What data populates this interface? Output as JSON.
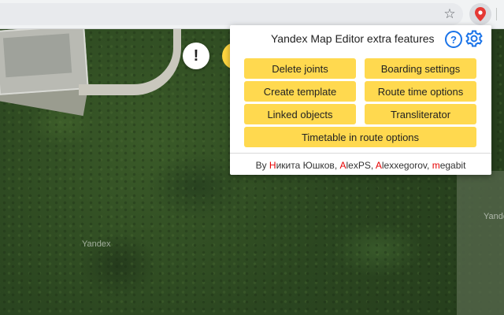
{
  "popup": {
    "title": "Yandex Map Editor extra features",
    "buttons": [
      {
        "label": "Delete joints"
      },
      {
        "label": "Boarding settings"
      },
      {
        "label": "Create template"
      },
      {
        "label": "Route time options"
      },
      {
        "label": "Linked objects"
      },
      {
        "label": "Transliterator"
      },
      {
        "label": "Timetable in route options"
      }
    ],
    "credits": {
      "prefix": "By ",
      "authors": [
        {
          "initial": "Н",
          "rest": "икита Юшков",
          "sep": ", "
        },
        {
          "initial": "A",
          "rest": "lexPS",
          "sep": ", "
        },
        {
          "initial": "A",
          "rest": "lexxegorov",
          "sep": ", "
        },
        {
          "initial": "m",
          "rest": "egabit",
          "sep": ""
        }
      ]
    }
  },
  "map": {
    "watermark_left": "Yandex",
    "watermark_right": "Yande",
    "warning_symbol": "!"
  },
  "icons": {
    "bookmark": "star-icon",
    "extension": "map-pin-icon",
    "help": "help-icon",
    "settings": "gear-icon"
  },
  "colors": {
    "button_bg": "#ffd94f",
    "accent": "#1a73e8",
    "author_initial": "#e60000"
  }
}
